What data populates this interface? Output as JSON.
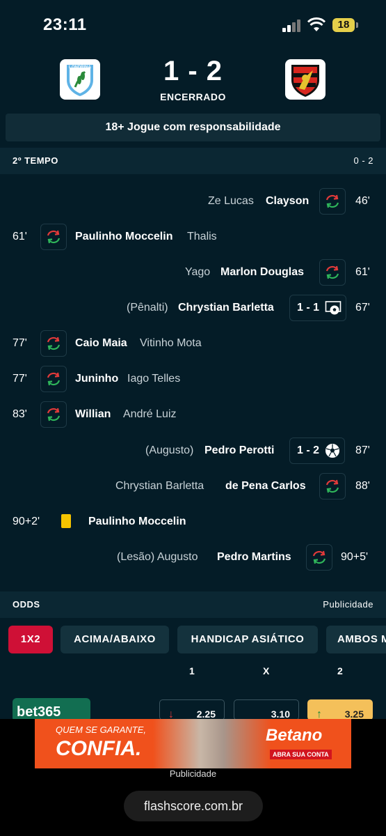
{
  "status_bar": {
    "time": "23:11",
    "battery": "18"
  },
  "match": {
    "home_team_logo_text": "LONDRINA",
    "score": "1 - 2",
    "status": "ENCERRADO"
  },
  "responsible_banner": "18+ Jogue com responsabilidade",
  "period": {
    "label": "2º TEMPO",
    "score": "0 - 2"
  },
  "events": {
    "e1": {
      "minute": "46'",
      "main": "Clayson",
      "secondary": "Ze Lucas"
    },
    "e2": {
      "minute": "61'",
      "main": "Paulinho Moccelin",
      "secondary": "Thalis"
    },
    "e3": {
      "minute": "61'",
      "main": "Marlon Douglas",
      "secondary": "Yago"
    },
    "e4": {
      "minute": "67'",
      "main": "Chrystian Barletta",
      "secondary": "(Pênalti)",
      "score": "1 - 1"
    },
    "e5": {
      "minute": "77'",
      "main": "Caio Maia",
      "secondary": "Vitinho Mota"
    },
    "e6": {
      "minute": "77'",
      "main": "Juninho",
      "secondary": "Iago Telles"
    },
    "e7": {
      "minute": "83'",
      "main": "Willian",
      "secondary": "André Luiz"
    },
    "e8": {
      "minute": "87'",
      "main": "Pedro Perotti",
      "secondary": "(Augusto)",
      "score": "1 - 2"
    },
    "e9": {
      "minute": "88'",
      "main": "de Pena Carlos",
      "secondary": "Chrystian Barletta"
    },
    "e10": {
      "minute": "90+2'",
      "main": "Paulinho Moccelin"
    },
    "e11": {
      "minute": "90+5'",
      "main": "Pedro Martins",
      "secondary": "(Lesão) Augusto"
    }
  },
  "odds_section": {
    "label": "ODDS",
    "ad_label": "Publicidade"
  },
  "tabs": {
    "t1": "1X2",
    "t2": "ACIMA/ABAIXO",
    "t3": "HANDICAP ASIÁTICO",
    "t4": "AMBOS M"
  },
  "odds_columns": {
    "c1": "1",
    "c2": "X",
    "c3": "2"
  },
  "bookmaker": {
    "name": "bet365"
  },
  "odds": {
    "o1": "2.25",
    "o2": "3.10",
    "o3": "3.25"
  },
  "ad": {
    "line1": "QUEM SE GARANTE,",
    "line2": "CONFIA.",
    "brand": "Betano",
    "cta": "ABRA SUA CONTA"
  },
  "ad_caption": "Publicidade",
  "browser_url": "flashscore.com.br",
  "colors": {
    "background": "#041c27",
    "accent_red": "#cf1036",
    "yellow_card": "#f5c400",
    "sub_green": "#2fb55a",
    "sub_red": "#e23a3a"
  },
  "icons": {
    "substitution": "substitution-icon",
    "goal": "soccer-ball-icon",
    "penalty": "penalty-goal-icon",
    "yellow_card": "yellow-card-icon"
  }
}
